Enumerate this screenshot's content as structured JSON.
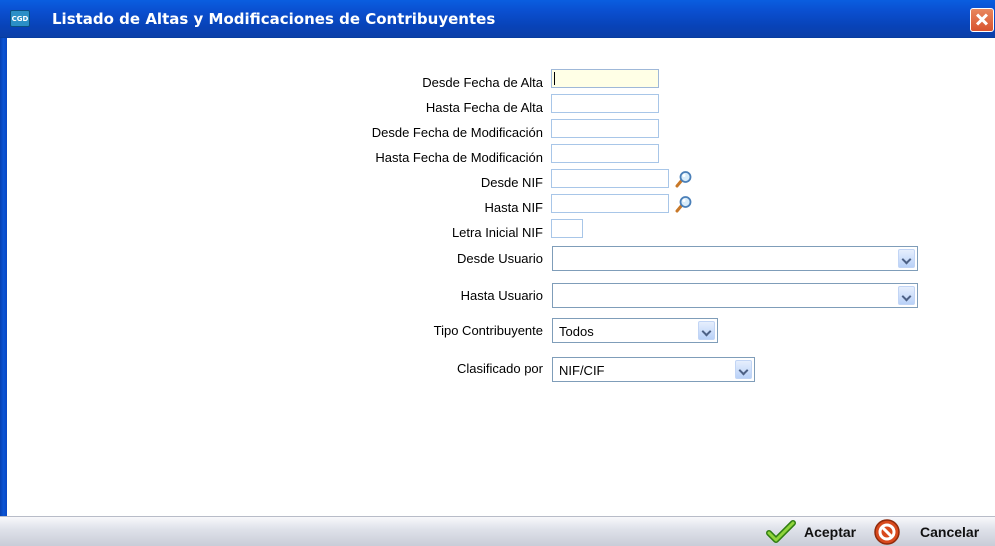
{
  "window": {
    "title": "Listado de Altas y Modificaciones de Contribuyentes",
    "app_icon_text": "CGD"
  },
  "form": {
    "desde_fecha_alta": {
      "label": "Desde Fecha de Alta",
      "value": ""
    },
    "hasta_fecha_alta": {
      "label": "Hasta Fecha de Alta",
      "value": ""
    },
    "desde_fecha_mod": {
      "label": "Desde Fecha de Modificación",
      "value": ""
    },
    "hasta_fecha_mod": {
      "label": "Hasta Fecha de Modificación",
      "value": ""
    },
    "desde_nif": {
      "label": "Desde NIF",
      "value": ""
    },
    "hasta_nif": {
      "label": "Hasta NIF",
      "value": ""
    },
    "letra_inicial_nif": {
      "label": "Letra Inicial NIF",
      "value": ""
    },
    "desde_usuario": {
      "label": "Desde Usuario",
      "value": ""
    },
    "hasta_usuario": {
      "label": "Hasta Usuario",
      "value": ""
    },
    "tipo_contribuyente": {
      "label": "Tipo Contribuyente",
      "value": "Todos"
    },
    "clasificado_por": {
      "label": "Clasificado por",
      "value": "NIF/CIF"
    }
  },
  "footer": {
    "accept_label": "Aceptar",
    "cancel_label": "Cancelar"
  },
  "colors": {
    "titlebar": "#0a4fd0",
    "active_field": "#ffffe6",
    "field_border": "#a8c6e8"
  }
}
